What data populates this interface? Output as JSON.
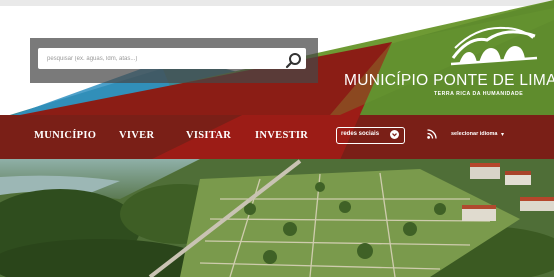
{
  "search": {
    "placeholder": "pesquisar (ex. águas, ldm, atas...)"
  },
  "brand": {
    "name": "MUNICÍPIO PONTE DE LIMA",
    "tagline": "TERRA RICA DA HUMANIDADE"
  },
  "nav": {
    "items": [
      {
        "label": "MUNICÍPIO"
      },
      {
        "label": "VIVER"
      },
      {
        "label": "VISITAR"
      },
      {
        "label": "INVESTIR"
      }
    ],
    "social_label": "redes sociais",
    "language_label": "selecionar idioma",
    "language_caret": "▾"
  },
  "colors": {
    "dark_red": "#7a1f17",
    "red": "#9c1c16",
    "green": "#6e9a34",
    "teal": "#3c8a95",
    "white": "#ffffff"
  }
}
